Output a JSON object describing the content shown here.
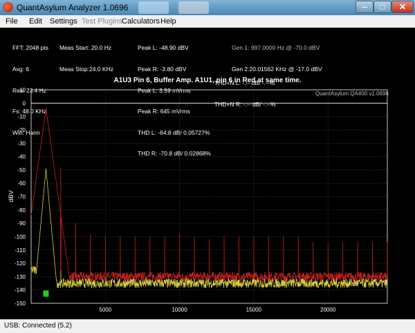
{
  "window": {
    "title": "QuantAsylum Analyzer 1.0696",
    "min_glyph": "─",
    "max_glyph": "□",
    "close_glyph": "✕"
  },
  "menu": [
    "File",
    "Edit",
    "Settings",
    "Test Plugins",
    "Calculators",
    "Help"
  ],
  "stats": {
    "fft": "FFT: 2048 pts",
    "avg": "Avg: 6",
    "res": "Res: 23.4 Hz",
    "fs": "Fs: 48.0 KHz",
    "win": "Win: Hann",
    "meas_start": "Meas Start: 20.0 Hz",
    "meas_stop": "Meas Stop:24.0 KHz",
    "peak_l_dbv": "Peak L: -48.90 dBV",
    "peak_r_dbv": "Peak R: -3.80 dBV",
    "peak_l_mv": "Peak L: 3.59 mVrms",
    "peak_r_mv": "Peak R: 645 mVrms",
    "thd_l": "THD L: -64.8 dB/ 0.05727%",
    "thd_r": "THD R: -70.8 dB/ 0.02868%",
    "thdn_l": "THD+N L: -.-- dB/ -.--%",
    "thdn_r": "THD+N R: -.-- dB/ -.--%",
    "gen1": "Gen 1: 997.0000 Hz @ -70.0 dBV",
    "gen2": "Gen 2:20.01562 KHz @ -17.0 dBV"
  },
  "plot": {
    "title": "A1U3 Pin 6, Buffer Amp.  A1U1, pin 6 in Red at same time.",
    "watermark": "QuantAsylum QA400 v1.0696",
    "ylabel": "dBV"
  },
  "chart_data": {
    "type": "line",
    "xlim": [
      0,
      24000
    ],
    "ylim": [
      -150,
      10
    ],
    "x_ticks": [
      5000,
      10000,
      15000,
      20000
    ],
    "y_ticks": [
      10,
      0,
      -10,
      -20,
      -30,
      -40,
      -50,
      -60,
      -70,
      -80,
      -90,
      -100,
      -110,
      -120,
      -130,
      -140,
      -150
    ],
    "grid": true,
    "reference_line": 0,
    "series": [
      {
        "color": "#cc2020",
        "fundamental_hz": 1000,
        "fundamental_db": -4,
        "harmonic_db": [
          -48,
          -90,
          -98,
          -100,
          -100,
          -100,
          -100,
          -100,
          -98,
          -100,
          -102,
          -100,
          -100,
          -100,
          -100,
          -100,
          -100,
          -104,
          -104,
          -104,
          -104,
          -104,
          -104
        ],
        "noise_floor_db": -130
      },
      {
        "color": "#d8d040",
        "fundamental_hz": 1000,
        "fundamental_db": -49,
        "harmonic_db": [
          -125
        ],
        "noise_floor_db": -135
      }
    ],
    "marker": {
      "x": 1000,
      "y": -143,
      "color": "#22cc22"
    }
  },
  "status": {
    "text": "USB: Connected    (5.2)"
  }
}
